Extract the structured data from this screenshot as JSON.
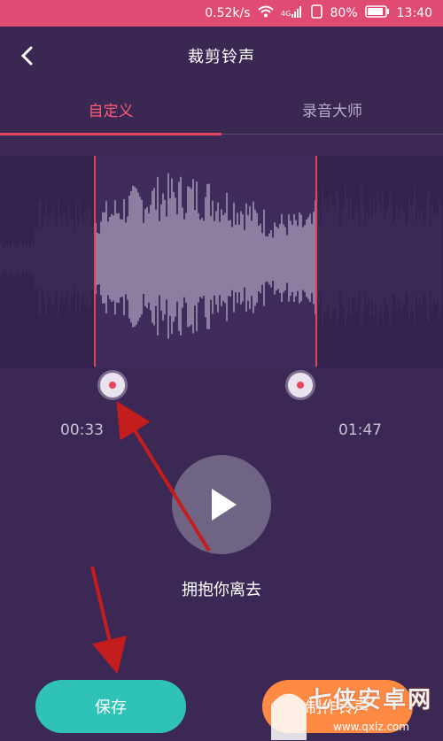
{
  "colors": {
    "accent": "#e9445e",
    "background": "#3b2854",
    "save": "#2fc3b8",
    "ringtone": "#ff8a44",
    "statusbar": "#df4b73"
  },
  "status_bar": {
    "speed": "0.52k/s",
    "battery": "80%",
    "time": "13:40",
    "icons": [
      "wifi-icon",
      "signal-icon",
      "sim-icon",
      "battery-icon"
    ]
  },
  "header": {
    "title": "裁剪铃声",
    "back_icon": "chevron-left-icon"
  },
  "tabs": [
    {
      "label": "自定义",
      "active": true
    },
    {
      "label": "录音大师",
      "active": false
    }
  ],
  "waveform": {
    "start_time": "00:33",
    "end_time": "01:47"
  },
  "player": {
    "play_icon": "play-icon",
    "song_title": "拥抱你离去"
  },
  "actions": {
    "save_label": "保存",
    "ringtone_label": "制作铃声"
  },
  "watermark": {
    "text": "七侠安卓网",
    "url": "www.qxlz.com"
  }
}
